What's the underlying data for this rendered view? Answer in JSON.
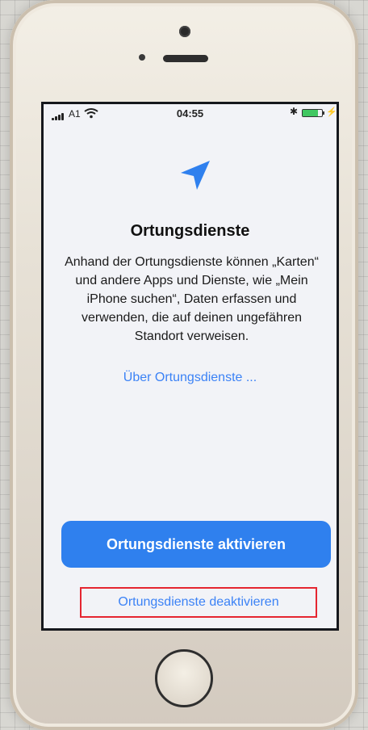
{
  "status_bar": {
    "carrier": "A1",
    "time": "04:55",
    "battery_level": 0.8
  },
  "screen": {
    "title": "Ortungsdienste",
    "description": "Anhand der Ortungsdienste können „Karten“ und andere Apps und Dienste, wie „Mein iPhone suchen“, Daten erfassen und verwenden, die auf deinen ungefähren Standort verweisen.",
    "info_link": "Über Ortungsdienste ...",
    "enable_button": "Ortungsdienste aktivieren",
    "disable_button": "Ortungsdienste deaktivieren"
  },
  "colors": {
    "accent": "#2f80ee",
    "link": "#3b82f6",
    "highlight_box": "#e52530"
  },
  "icons": {
    "location": "location-arrow-icon",
    "wifi": "wifi-icon",
    "bluetooth": "bluetooth-icon",
    "battery": "battery-icon"
  }
}
